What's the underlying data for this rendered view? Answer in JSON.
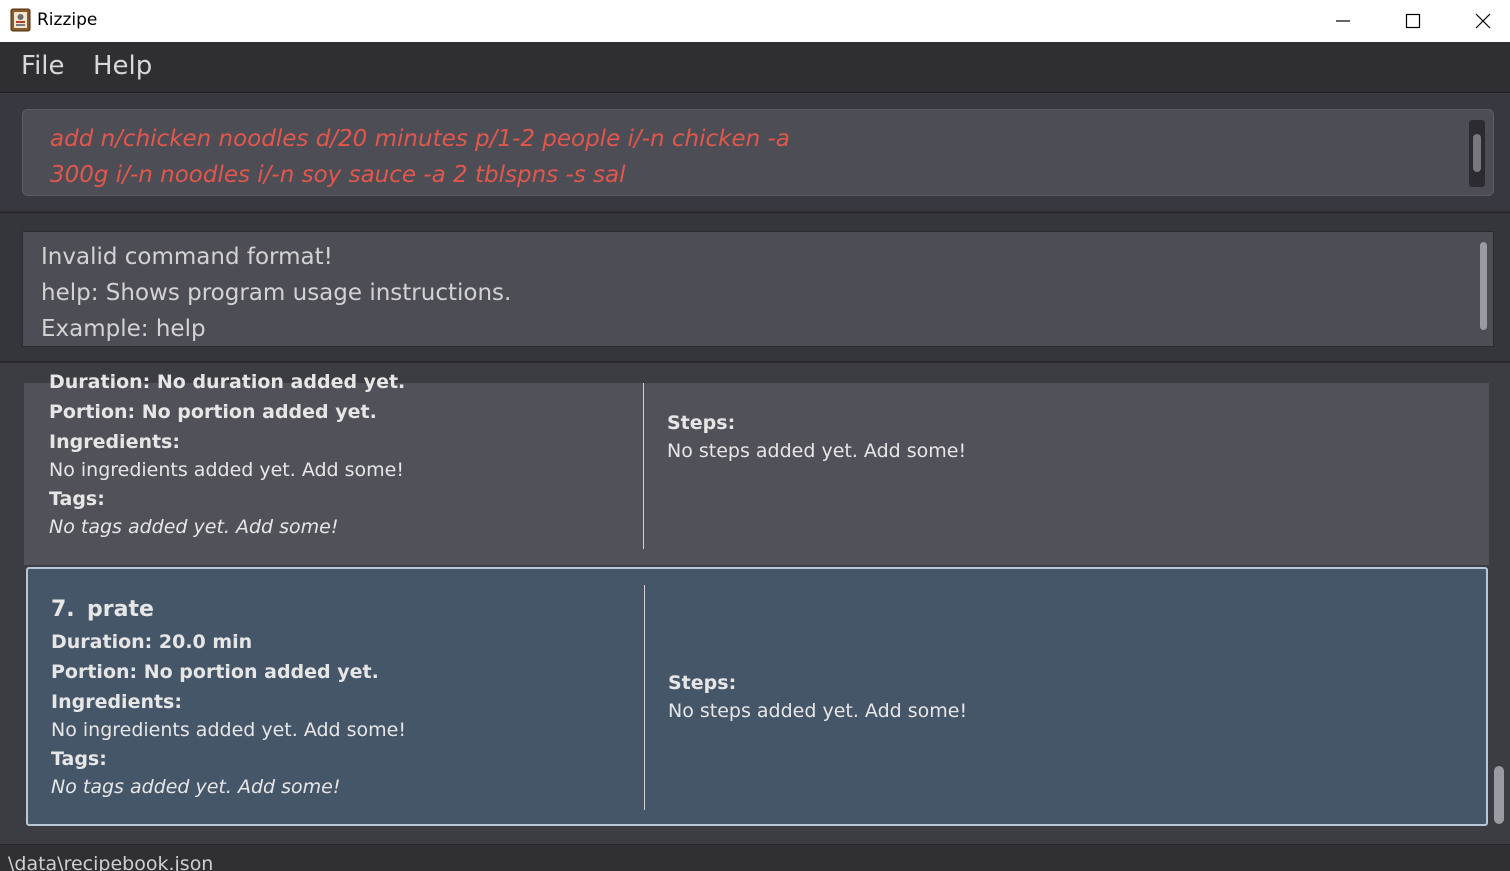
{
  "window": {
    "title": "Rizzipe",
    "icon": "recipe-book-icon",
    "controls": [
      "minimize-icon",
      "maximize-icon",
      "close-icon"
    ]
  },
  "menu": {
    "file_label": "File",
    "help_label": "Help"
  },
  "command": {
    "value": "add n/chicken noodles d/20 minutes p/1-2 people i/-n chicken -a 300g i/-n noodles i/-n soy sauce -a 2 tblspns -s sal",
    "color": "#e2574c"
  },
  "result": {
    "lines": [
      "Invalid command format!",
      "help: Shows program usage instructions.",
      "Example: help"
    ]
  },
  "recipes": [
    {
      "duration_text": "Duration: No duration added yet.",
      "portion_text": "Portion: No portion added yet.",
      "ingredients_label": "Ingredients:",
      "ingredients_text": "No ingredients added yet. Add some!",
      "tags_label": "Tags:",
      "tags_text": "No tags added yet. Add some!",
      "steps_label": "Steps:",
      "steps_text": "No steps added yet. Add some!"
    },
    {
      "index": "7.",
      "name": "prate",
      "duration_text": "Duration: 20.0 min",
      "portion_text": "Portion: No portion added yet.",
      "ingredients_label": "Ingredients:",
      "ingredients_text": "No ingredients added yet. Add some!",
      "tags_label": "Tags:",
      "tags_text": "No tags added yet. Add some!",
      "steps_label": "Steps:",
      "steps_text": "No steps added yet. Add some!",
      "selected": true
    }
  ],
  "status": {
    "path": "\\data\\recipebook.json"
  }
}
